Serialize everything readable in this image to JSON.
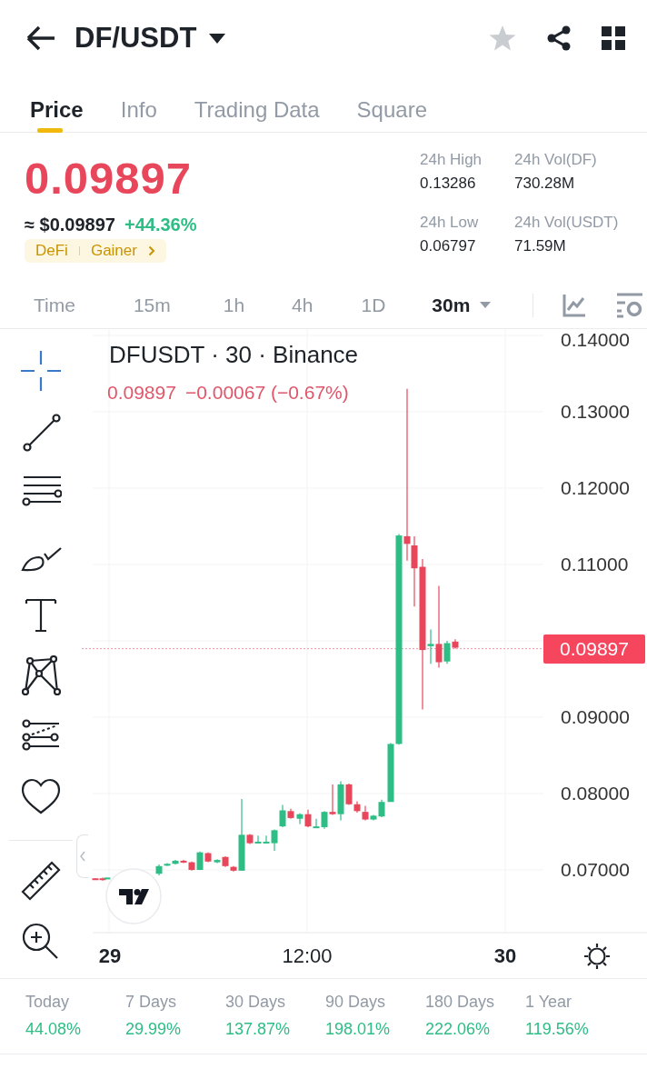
{
  "header": {
    "title": "DF/USDT",
    "favorite": false
  },
  "tabs": [
    {
      "label": "Price",
      "selected": true
    },
    {
      "label": "Info",
      "selected": false
    },
    {
      "label": "Trading Data",
      "selected": false
    },
    {
      "label": "Square",
      "selected": false
    }
  ],
  "price": {
    "last": "0.09897",
    "usd": "≈ $0.09897",
    "change": "+44.36%",
    "tags": [
      "DeFi",
      "Gainer"
    ]
  },
  "stats": [
    {
      "label": "24h High",
      "value": "0.13286"
    },
    {
      "label": "24h Vol(DF)",
      "value": "730.28M"
    },
    {
      "label": "24h Low",
      "value": "0.06797"
    },
    {
      "label": "24h Vol(USDT)",
      "value": "71.59M"
    }
  ],
  "intervals": [
    {
      "label": "Time",
      "selected": false
    },
    {
      "label": "15m",
      "selected": false
    },
    {
      "label": "1h",
      "selected": false
    },
    {
      "label": "4h",
      "selected": false
    },
    {
      "label": "1D",
      "selected": false
    },
    {
      "label": "30m",
      "selected": true
    }
  ],
  "chart": {
    "title": "DFUSDT · 30 · Binance",
    "quote_value": "0.09897",
    "quote_change": "−0.00067 (−0.67%)",
    "y_labels": [
      "0.14000",
      "0.13000",
      "0.12000",
      "0.11000",
      "0.09000",
      "0.08000",
      "0.07000"
    ],
    "price_tag": "0.09897",
    "x_labels": [
      {
        "label": "29",
        "kind": "day"
      },
      {
        "label": "12:00",
        "kind": "time"
      },
      {
        "label": "30",
        "kind": "day"
      }
    ]
  },
  "periods": [
    {
      "label": "Today",
      "value": "44.08%"
    },
    {
      "label": "7 Days",
      "value": "29.99%"
    },
    {
      "label": "30 Days",
      "value": "137.87%"
    },
    {
      "label": "90 Days",
      "value": "198.01%"
    },
    {
      "label": "180 Days",
      "value": "222.06%"
    },
    {
      "label": "1 Year",
      "value": "119.56%"
    }
  ]
}
